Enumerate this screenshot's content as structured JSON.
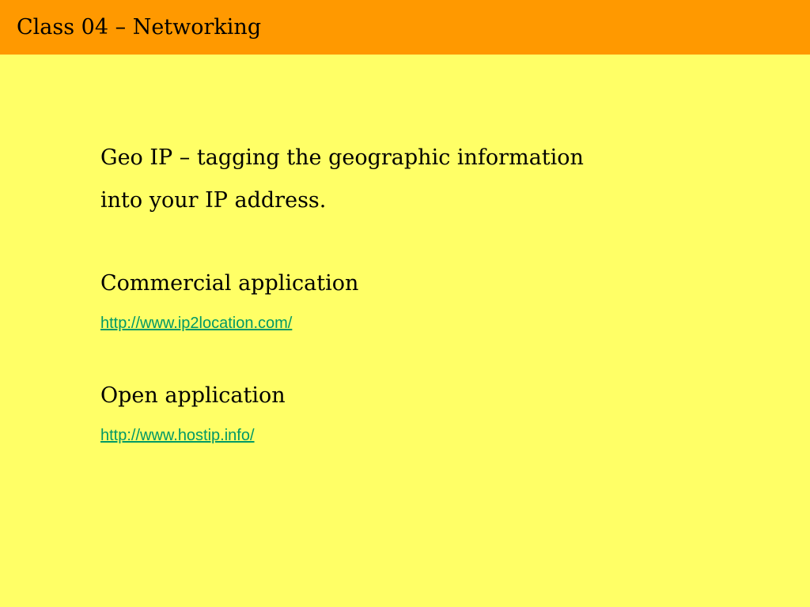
{
  "slide": {
    "title": "Class 04 – Networking",
    "intro_line_1": "Geo IP – tagging the geographic information",
    "intro_line_2": "into your IP address.",
    "commercial_heading": "Commercial application",
    "commercial_link": "http://www.ip2location.com/",
    "open_heading": "Open application",
    "open_link": "http://www.hostip.info/"
  },
  "colors": {
    "background": "#FFFF66",
    "title_bar": "#FF9900",
    "link": "#009966"
  }
}
